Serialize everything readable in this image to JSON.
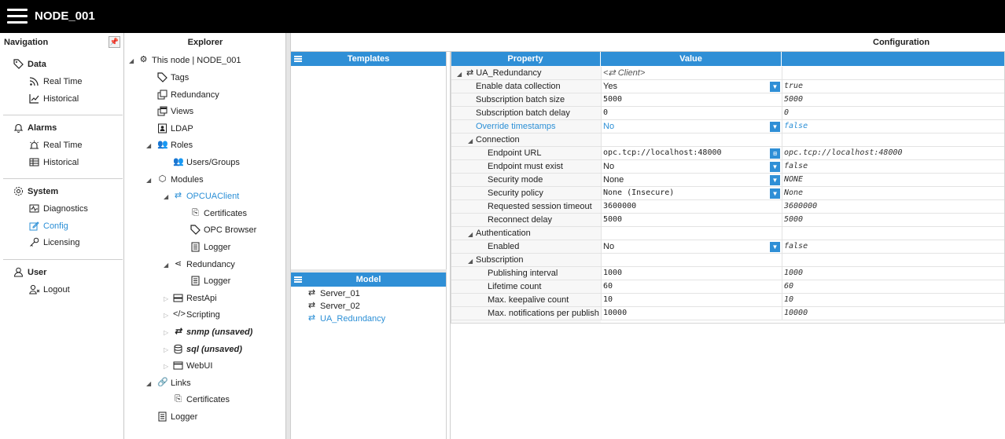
{
  "app": {
    "title": "NODE_001"
  },
  "navigation": {
    "header": "Navigation",
    "groups": [
      {
        "title": "Data",
        "icon": "tag-icon",
        "items": [
          {
            "label": "Real Time",
            "icon": "rss-icon"
          },
          {
            "label": "Historical",
            "icon": "line-chart-icon"
          }
        ]
      },
      {
        "title": "Alarms",
        "icon": "bell-icon",
        "items": [
          {
            "label": "Real Time",
            "icon": "alarm-light-icon"
          },
          {
            "label": "Historical",
            "icon": "table-icon"
          }
        ]
      },
      {
        "title": "System",
        "icon": "gear-icon",
        "items": [
          {
            "label": "Diagnostics",
            "icon": "pulse-icon"
          },
          {
            "label": "Config",
            "icon": "edit-icon"
          },
          {
            "label": "Licensing",
            "icon": "key-icon"
          }
        ]
      },
      {
        "title": "User",
        "icon": "user-icon",
        "items": [
          {
            "label": "Logout",
            "icon": "logout-icon"
          }
        ]
      }
    ]
  },
  "explorer": {
    "header": "Explorer",
    "tree": [
      "This node | NODE_001",
      "Tags",
      "Redundancy",
      "Views",
      "LDAP",
      "Roles",
      "Users/Groups",
      "Modules",
      "OPCUAClient",
      "Certificates",
      "OPC Browser",
      "Logger",
      "Redundancy",
      "Logger",
      "RestApi",
      "Scripting",
      "snmp (unsaved)",
      "sql (unsaved)",
      "WebUI",
      "Links",
      "Certificates",
      "Logger"
    ]
  },
  "templates": {
    "header": "Templates"
  },
  "model": {
    "header": "Model",
    "items": [
      "Server_01",
      "Server_02",
      "UA_Redundancy"
    ]
  },
  "configuration": {
    "header": "Configuration",
    "columns": [
      "Property",
      "Value",
      ""
    ],
    "rows": [
      {
        "prop": "UA_Redundancy",
        "value": "<⇄ Client>",
        "default": ""
      },
      {
        "prop": "Enable data collection",
        "value": "Yes",
        "default": "true"
      },
      {
        "prop": "Subscription batch size",
        "value": "5000",
        "default": "5000"
      },
      {
        "prop": "Subscription batch delay",
        "value": "0",
        "default": "0"
      },
      {
        "prop": "Override timestamps",
        "value": "No",
        "default": "false"
      },
      {
        "prop": "Connection",
        "value": "",
        "default": ""
      },
      {
        "prop": "Endpoint URL",
        "value": "opc.tcp://localhost:48000",
        "default": "opc.tcp://localhost:48000"
      },
      {
        "prop": "Endpoint must exist",
        "value": "No",
        "default": "false"
      },
      {
        "prop": "Security mode",
        "value": "None",
        "default": "NONE"
      },
      {
        "prop": "Security policy",
        "value": "None (Insecure)",
        "default": "None"
      },
      {
        "prop": "Requested session timeout",
        "value": "3600000",
        "default": "3600000"
      },
      {
        "prop": "Reconnect delay",
        "value": "5000",
        "default": "5000"
      },
      {
        "prop": "Authentication",
        "value": "",
        "default": ""
      },
      {
        "prop": "Enabled",
        "value": "No",
        "default": "false"
      },
      {
        "prop": "Subscription",
        "value": "",
        "default": ""
      },
      {
        "prop": "Publishing interval",
        "value": "1000",
        "default": "1000"
      },
      {
        "prop": "Lifetime count",
        "value": "60",
        "default": "60"
      },
      {
        "prop": "Max. keepalive count",
        "value": "10",
        "default": "10"
      },
      {
        "prop": "Max. notifications per publish",
        "value": "10000",
        "default": "10000"
      }
    ]
  },
  "colors": {
    "accent": "#2f8fd6",
    "topbar": "#000000",
    "link": "#2b8fd6"
  }
}
